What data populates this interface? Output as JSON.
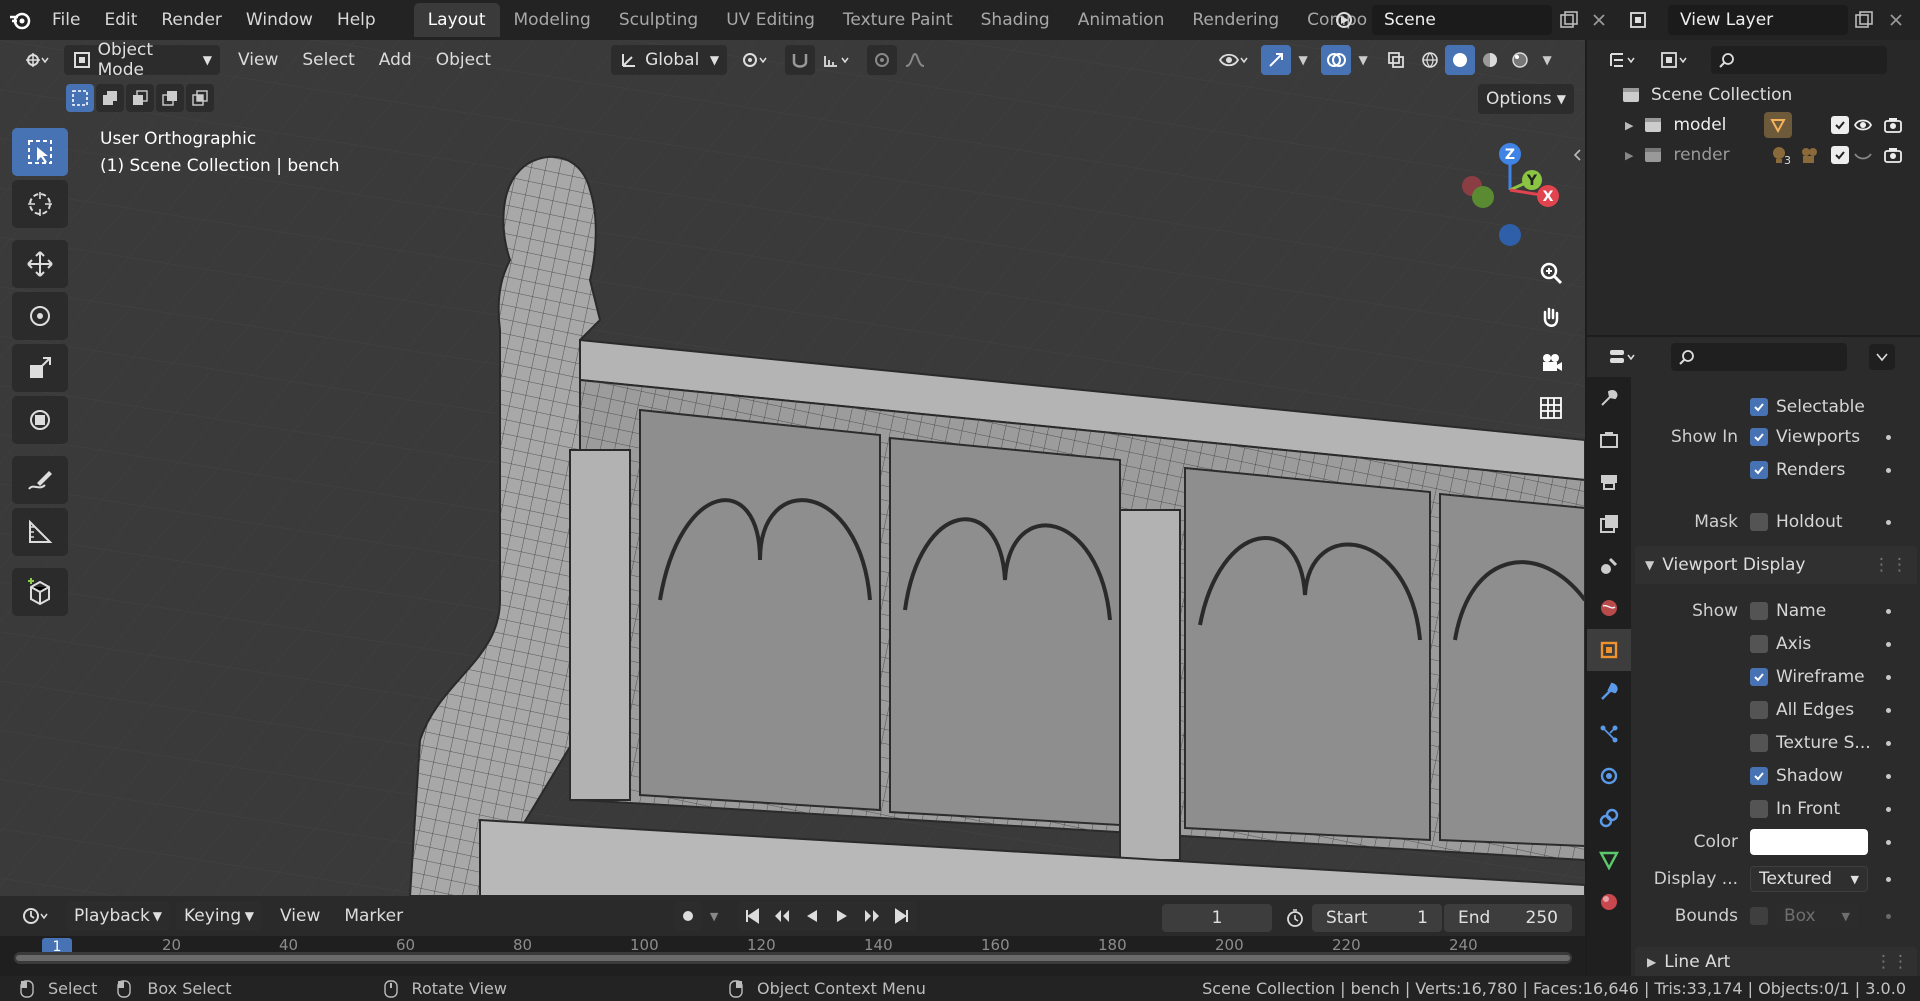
{
  "app": {
    "menus": [
      "File",
      "Edit",
      "Render",
      "Window",
      "Help"
    ],
    "workspaces": [
      "Layout",
      "Modeling",
      "Sculpting",
      "UV Editing",
      "Texture Paint",
      "Shading",
      "Animation",
      "Rendering",
      "Compo"
    ],
    "active_workspace": "Layout",
    "scene_name": "Scene",
    "view_layer": "View Layer"
  },
  "viewport": {
    "mode": "Object Mode",
    "menus": [
      "View",
      "Select",
      "Add",
      "Object"
    ],
    "transform_orientation": "Global",
    "options_label": "Options",
    "view_name": "User Orthographic",
    "context_line": "(1) Scene Collection | bench",
    "gizmo_axes": {
      "z": "Z",
      "y": "Y",
      "x": "X"
    }
  },
  "timeline": {
    "menus": [
      "Playback",
      "Keying",
      "View",
      "Marker"
    ],
    "current_frame": "1",
    "start_label": "Start",
    "start_value": "1",
    "end_label": "End",
    "end_value": "250",
    "ruler_ticks": [
      "1",
      "20",
      "40",
      "60",
      "80",
      "100",
      "120",
      "140",
      "160",
      "180",
      "200",
      "220",
      "240"
    ]
  },
  "outliner": {
    "root": "Scene Collection",
    "items": [
      {
        "name": "model"
      },
      {
        "name": "render",
        "badge": "3"
      }
    ]
  },
  "properties": {
    "selectable_label": "Selectable",
    "show_in_label": "Show In",
    "viewports_label": "Viewports",
    "renders_label": "Renders",
    "mask_label": "Mask",
    "holdout_label": "Holdout",
    "viewport_display_label": "Viewport Display",
    "show_label": "Show",
    "name_label": "Name",
    "axis_label": "Axis",
    "wireframe_label": "Wireframe",
    "all_edges_label": "All Edges",
    "texture_space_label": "Texture S...",
    "shadow_label": "Shadow",
    "in_front_label": "In Front",
    "color_label": "Color",
    "display_as_label": "Display ...",
    "display_as_value": "Textured",
    "bounds_label": "Bounds",
    "bounds_value": "Box",
    "line_art_label": "Line Art",
    "checkbox_states": {
      "selectable": true,
      "viewports": true,
      "renders": true,
      "holdout": false,
      "name": false,
      "axis": false,
      "wireframe": true,
      "all_edges": false,
      "texture_space": false,
      "shadow": true,
      "in_front": false,
      "bounds": false
    },
    "color_value": "#ffffff"
  },
  "statusbar": {
    "select": "Select",
    "box_select": "Box Select",
    "rotate_view": "Rotate View",
    "context_menu": "Object Context Menu",
    "stats": "Scene Collection | bench | Verts:16,780 | Faces:16,646 | Tris:33,174 | Objects:0/1 | 3.0.0"
  },
  "colors": {
    "accent": "#4772b3",
    "x_axis": "#e2444f",
    "y_axis": "#8ac442",
    "z_axis": "#3f84e5"
  }
}
